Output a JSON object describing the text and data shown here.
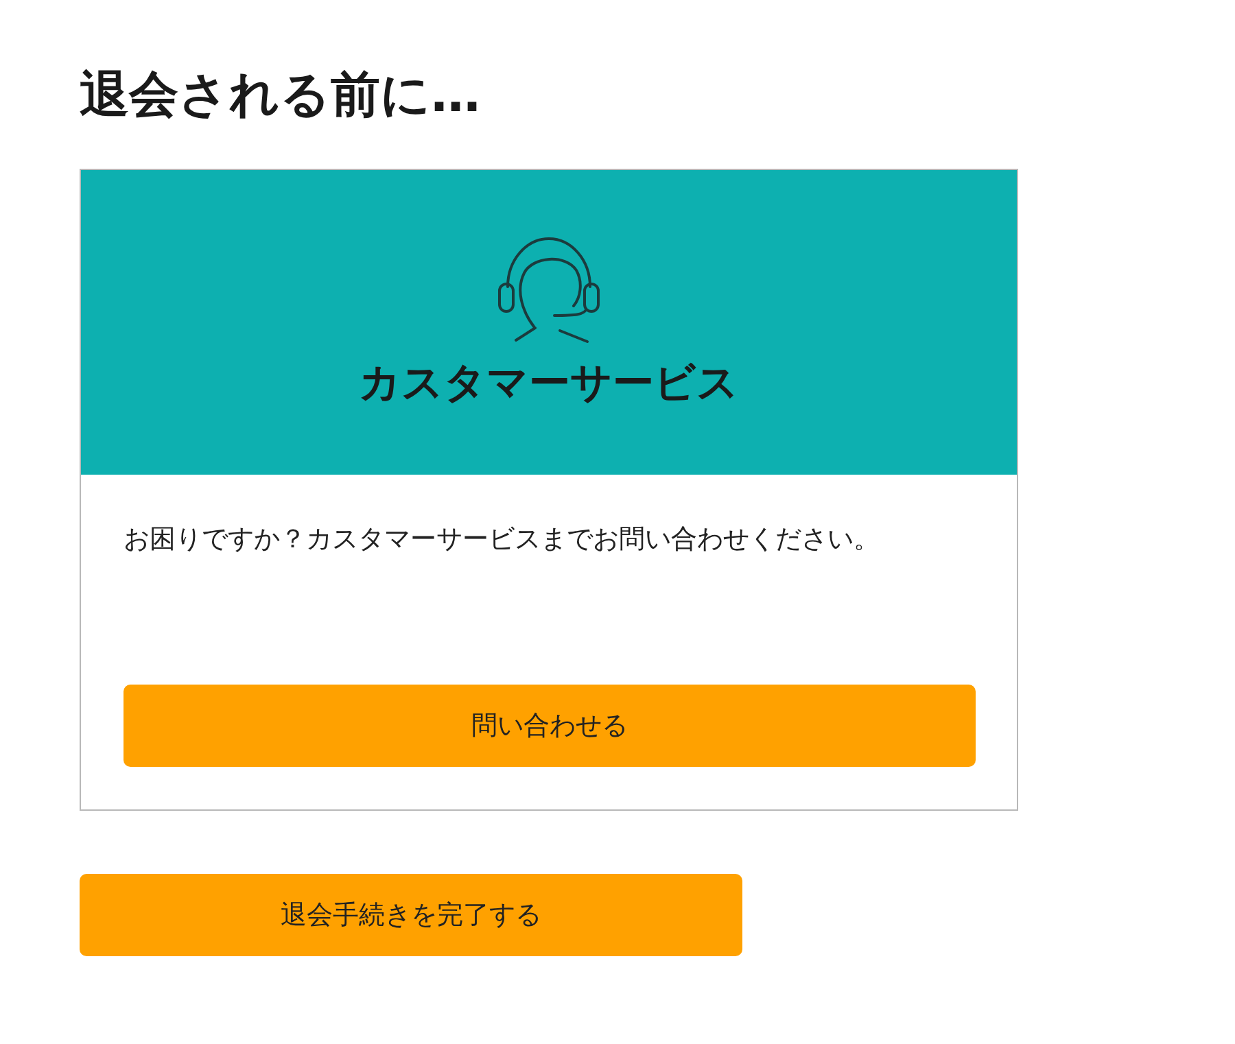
{
  "heading": "退会される前に…",
  "support_card": {
    "title": "カスタマーサービス",
    "message": "お困りですか？カスタマーサービスまでお問い合わせください。",
    "button": "問い合わせる"
  },
  "complete_button": "退会手続きを完了する"
}
